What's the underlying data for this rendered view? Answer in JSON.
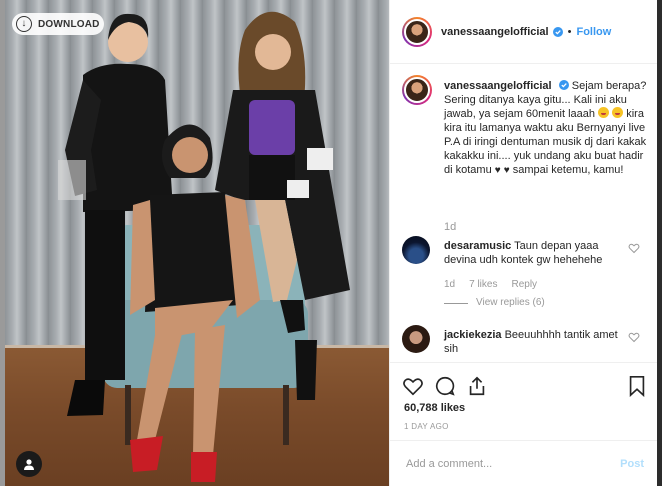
{
  "photo": {
    "download_label": "DOWNLOAD",
    "download_icon": "download-icon",
    "tag_icon": "user-tag-icon"
  },
  "header": {
    "username": "vanessaangelofficial",
    "separator": "•",
    "follow_label": "Follow",
    "verified_icon": "verified-badge-icon"
  },
  "caption": {
    "username": "vanessaangelofficial",
    "line1": "Sejam berapa?",
    "line2": "Sering ditanya kaya gitu... Kali ini aku jawab, ya sejam 60menit laaah",
    "line3": "kira kira itu lamanya waktu aku Bernyanyi live P.A di iringi dentuman musik dj dari kakak kakakku ini.... yuk undang aku buat hadir di kotamu",
    "line4": "sampai ketemu, kamu!",
    "time": "1d"
  },
  "comments": [
    {
      "username": "desaramusic",
      "text": "Taun depan yaaa devina udh kontek gw hehehehe",
      "time": "1d",
      "likes": "7 likes",
      "reply_label": "Reply",
      "view_replies": "View replies (6)"
    },
    {
      "username": "jackiekezia",
      "text": "Beeuuhhhh tantik amet sih"
    }
  ],
  "actions": {
    "likes": "60,788 likes",
    "posted": "1 DAY AGO"
  },
  "add_comment": {
    "placeholder": "Add a comment...",
    "post_label": "Post"
  },
  "colors": {
    "accent": "#3897f0",
    "post_disabled": "#b2dffc",
    "muted": "#999999"
  }
}
